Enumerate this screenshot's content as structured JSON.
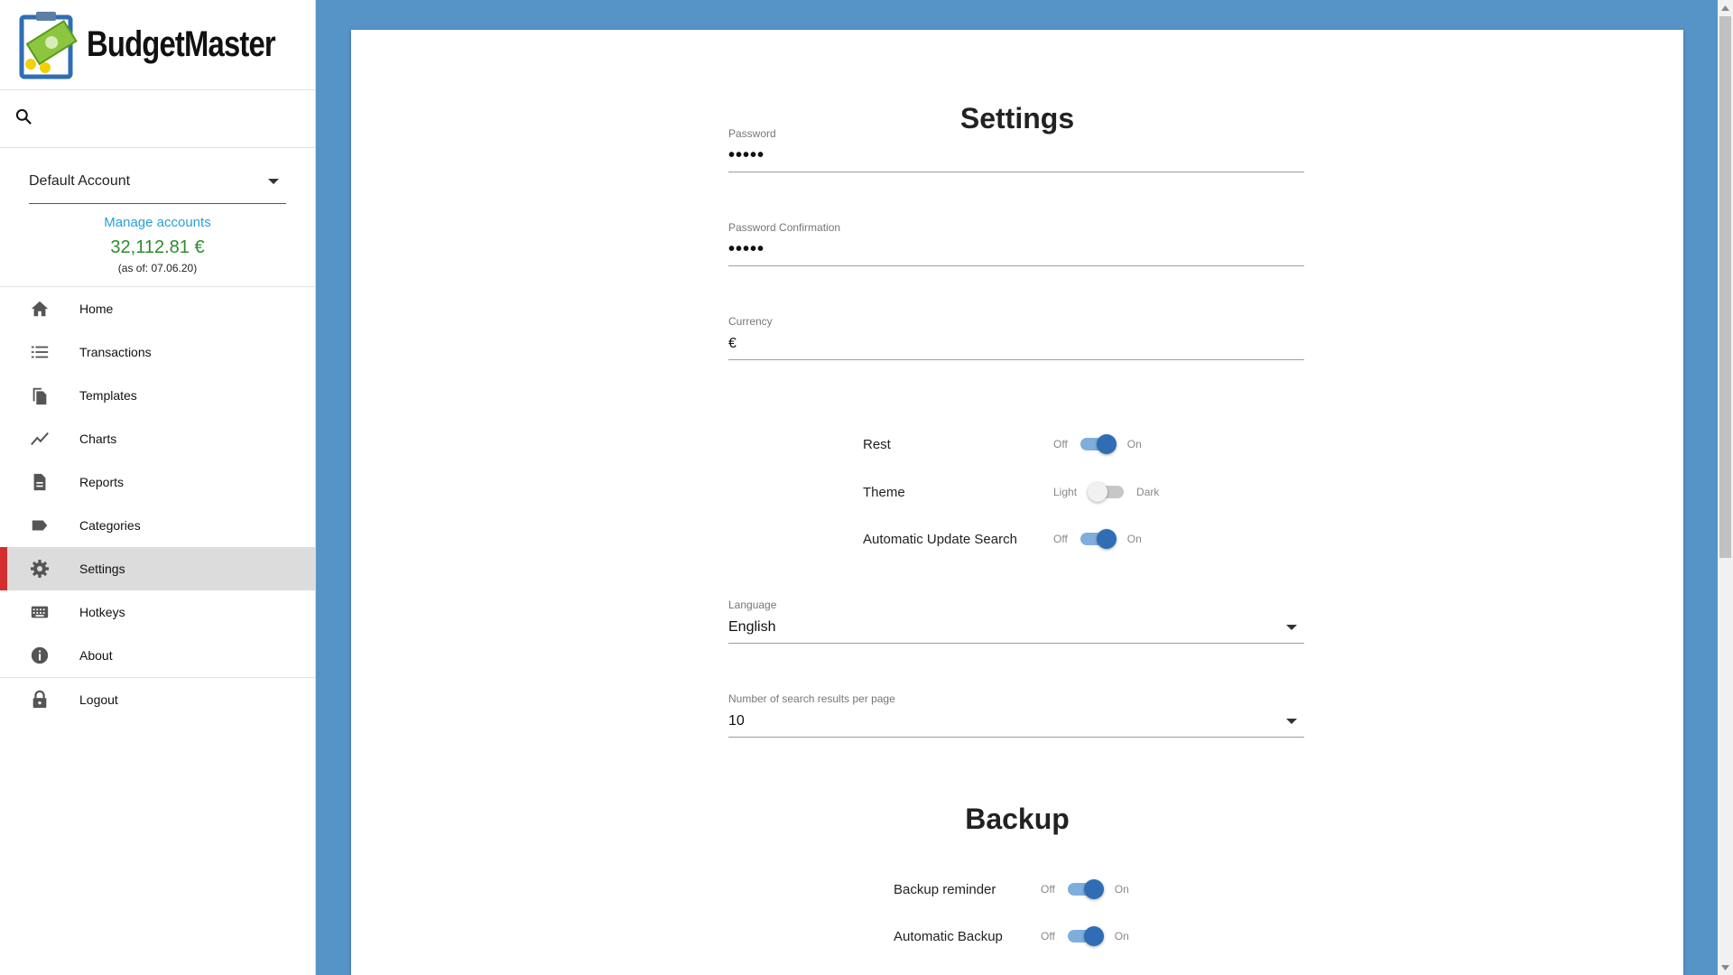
{
  "app": {
    "name": "BudgetMaster"
  },
  "sidebar": {
    "account": {
      "selected": "Default Account",
      "manage_label": "Manage accounts",
      "balance": "32,112.81 €",
      "as_of": "(as of: 07.06.20)"
    },
    "items": [
      {
        "label": "Home",
        "icon": "home-icon"
      },
      {
        "label": "Transactions",
        "icon": "list-icon"
      },
      {
        "label": "Templates",
        "icon": "copy-icon"
      },
      {
        "label": "Charts",
        "icon": "chart-line-icon"
      },
      {
        "label": "Reports",
        "icon": "document-icon"
      },
      {
        "label": "Categories",
        "icon": "label-icon"
      },
      {
        "label": "Settings",
        "icon": "gear-icon",
        "active": true
      },
      {
        "label": "Hotkeys",
        "icon": "keyboard-icon"
      },
      {
        "label": "About",
        "icon": "info-icon"
      },
      {
        "label": "Logout",
        "icon": "lock-icon"
      }
    ]
  },
  "settings": {
    "title": "Settings",
    "password": {
      "label": "Password",
      "value": "•••••"
    },
    "password_confirmation": {
      "label": "Password Confirmation",
      "value": "•••••"
    },
    "currency": {
      "label": "Currency",
      "value": "€"
    },
    "switches": [
      {
        "name": "Rest",
        "off": "Off",
        "on": "On",
        "state": true
      },
      {
        "name": "Theme",
        "off": "Light",
        "on": "Dark",
        "state": false
      },
      {
        "name": "Automatic Update Search",
        "off": "Off",
        "on": "On",
        "state": true
      }
    ],
    "language": {
      "label": "Language",
      "value": "English"
    },
    "search_results": {
      "label": "Number of search results per page",
      "value": "10"
    }
  },
  "backup": {
    "title": "Backup",
    "switches": [
      {
        "name": "Backup reminder",
        "off": "Off",
        "on": "On",
        "state": true
      },
      {
        "name": "Automatic Backup",
        "off": "Off",
        "on": "On",
        "state": true
      }
    ]
  },
  "colors": {
    "background": "#5693c7",
    "accent": "#2f6db5",
    "active_marker": "#d32f2f",
    "link": "#2a9fd6",
    "balance": "#2e8b2e"
  }
}
